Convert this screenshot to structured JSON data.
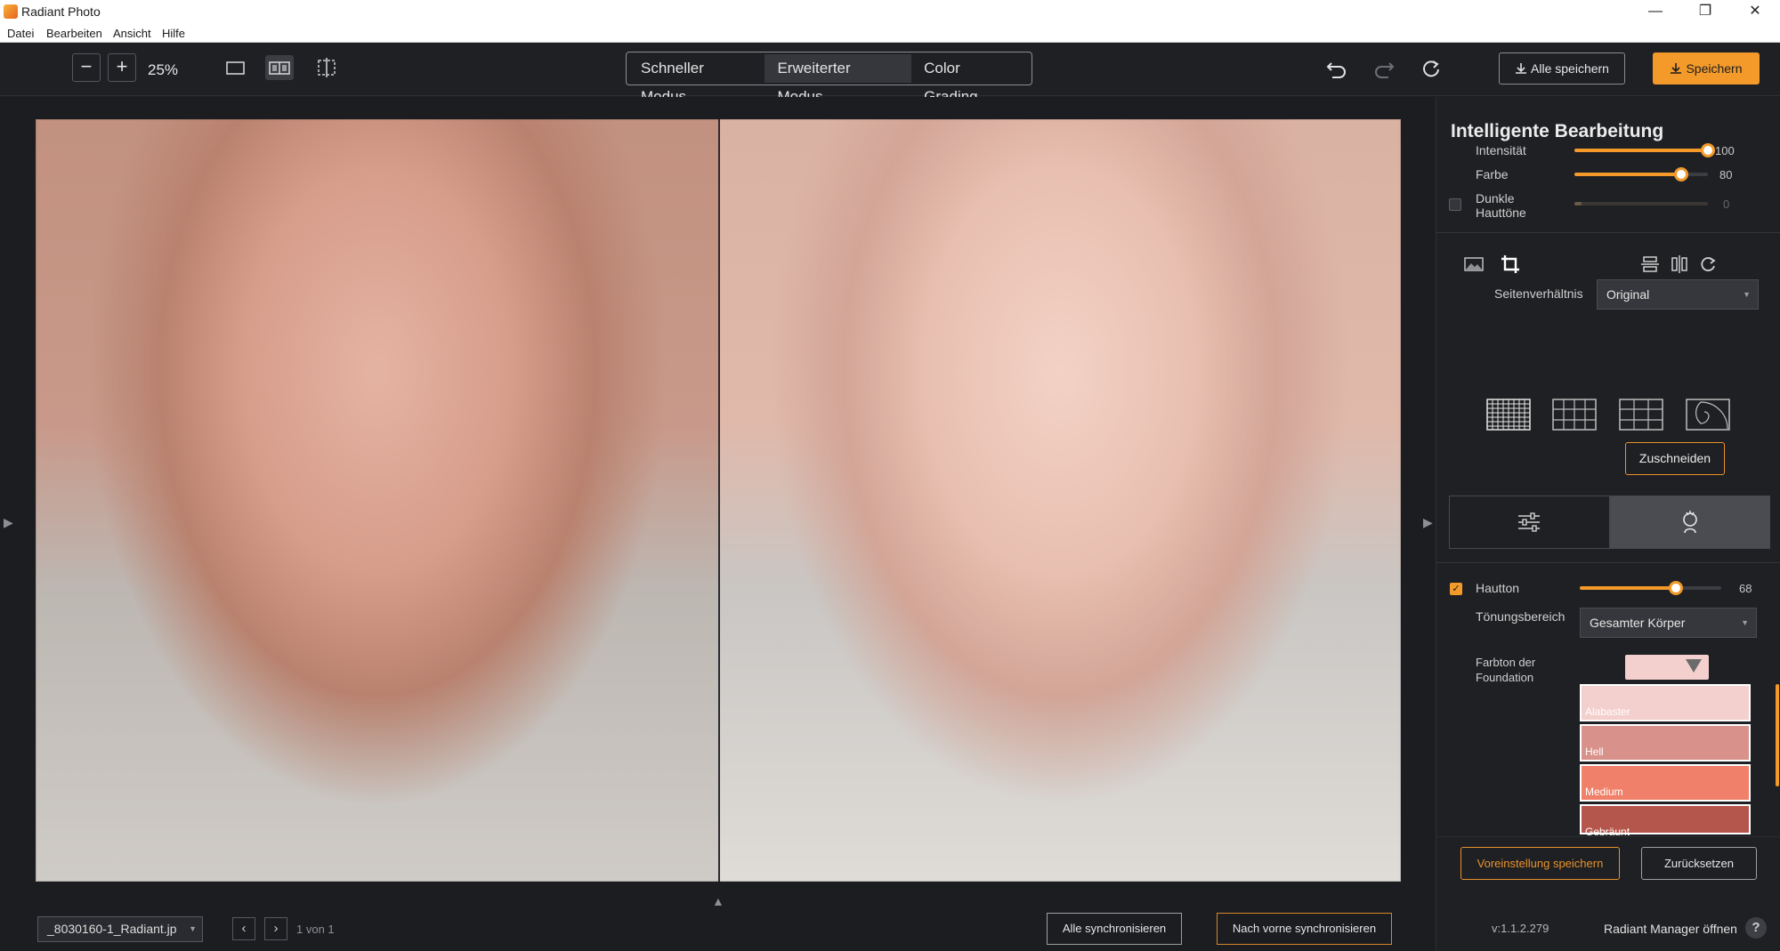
{
  "window": {
    "title": "Radiant Photo",
    "minimize_glyph": "—",
    "restore_glyph": "❐",
    "close_glyph": "✕"
  },
  "menu": [
    "Datei",
    "Bearbeiten",
    "Ansicht",
    "Hilfe"
  ],
  "toolbar": {
    "zoom_out_glyph": "−",
    "zoom_in_glyph": "+",
    "zoom_value": "25%",
    "modes": [
      {
        "label": "Schneller Modus",
        "active": false
      },
      {
        "label": "Erweiterter Modus",
        "active": true
      },
      {
        "label": "Color Grading",
        "active": false
      }
    ],
    "save_all_label": "Alle speichern",
    "save_label": "Speichern",
    "icons": [
      "single-view-icon",
      "split-view-icon",
      "compare-view-icon",
      "undo-icon",
      "redo-icon",
      "reset-icon",
      "download-icon"
    ]
  },
  "bottom_bar": {
    "file_name": "_8030160-1_Radiant.jp",
    "prev_glyph": "‹",
    "next_glyph": "›",
    "page_info": "1 von 1",
    "sync_all_label": "Alle synchronisieren",
    "sync_forward_label": "Nach vorne synchronisieren"
  },
  "panel": {
    "title": "Intelligente Bearbeitung",
    "sliders": [
      {
        "label": "Intensität",
        "value": 100,
        "max": 100,
        "shown": "100"
      },
      {
        "label": "Farbe",
        "value": 80,
        "max": 100,
        "shown": "80"
      }
    ],
    "dark_skin": {
      "label_line1": "Dunkle",
      "label_line2": "Hauttöne",
      "value": 0,
      "shown": "0",
      "checked": false
    },
    "crop": {
      "aspect_label": "Seitenverhältnis",
      "aspect_value": "Original",
      "grid_options": [
        "fine-grid-icon",
        "grid-4x3-icon",
        "grid-3x3-icon",
        "golden-spiral-icon"
      ],
      "crop_button": "Zuschneiden"
    },
    "skin": {
      "label": "Hautton",
      "checked": true,
      "value": 68,
      "max": 100,
      "shown": "68",
      "range_label": "Tönungsbereich",
      "range_value": "Gesamter Körper",
      "foundation_label_line1": "Farbton der",
      "foundation_label_line2": "Foundation",
      "selected_color": "#f3cfcd",
      "swatches": [
        {
          "name": "Alabaster",
          "color": "#f3cfcd"
        },
        {
          "name": "Hell",
          "color": "#d9918b"
        },
        {
          "name": "Medium",
          "color": "#f0806a"
        },
        {
          "name": "Gebräunt",
          "color": "#b5564c"
        }
      ]
    },
    "save_preset_label": "Voreinstellung speichern",
    "reset_label": "Zurücksetzen",
    "version": "v:1.1.2.279",
    "manager_label": "Radiant Manager öffnen",
    "help_glyph": "?"
  },
  "colors": {
    "accent": "#f39a2b",
    "background": "#1e1f22",
    "panel": "#1f2023"
  }
}
